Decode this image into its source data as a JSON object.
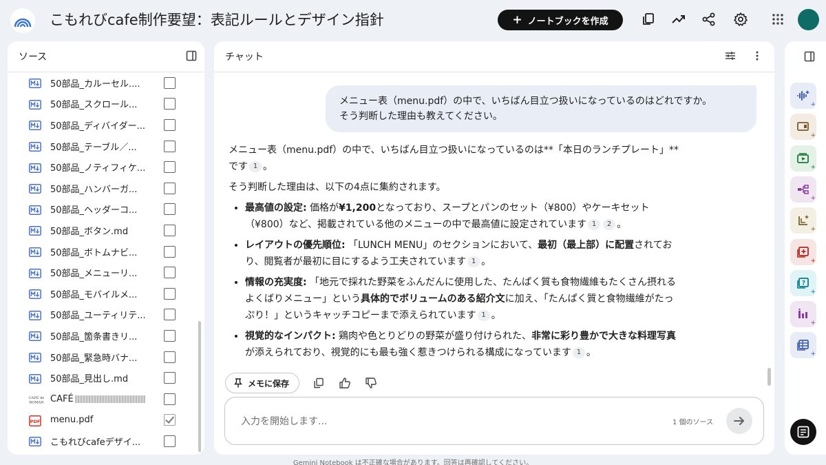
{
  "app": {
    "title": "こもれびcafe制作要望：表記ルールとデザイン指針",
    "create_notebook_label": "ノートブックを作成"
  },
  "sources_panel": {
    "title": "ソース",
    "items": [
      {
        "label": "50部品_カルーセル....",
        "icon": "markdown-icon",
        "checked": false
      },
      {
        "label": "50部品_スクロール...",
        "icon": "markdown-icon",
        "checked": false
      },
      {
        "label": "50部品_ディバイダー...",
        "icon": "markdown-icon",
        "checked": false
      },
      {
        "label": "50部品_テーブル／...",
        "icon": "markdown-icon",
        "checked": false
      },
      {
        "label": "50部品_ノティフィケ...",
        "icon": "markdown-icon",
        "checked": false
      },
      {
        "label": "50部品_ハンバーガ...",
        "icon": "markdown-icon",
        "checked": false
      },
      {
        "label": "50部品_ヘッダーコ...",
        "icon": "markdown-icon",
        "checked": false
      },
      {
        "label": "50部品_ボタン.md",
        "icon": "markdown-icon",
        "checked": false
      },
      {
        "label": "50部品_ボトムナビ...",
        "icon": "markdown-icon",
        "checked": false
      },
      {
        "label": "50部品_メニューリ...",
        "icon": "markdown-icon",
        "checked": false
      },
      {
        "label": "50部品_モバイルメ...",
        "icon": "markdown-icon",
        "checked": false
      },
      {
        "label": "50部品_ユーティリテ...",
        "icon": "markdown-icon",
        "checked": false
      },
      {
        "label": "50部品_箇条書きリ...",
        "icon": "markdown-icon",
        "checked": false
      },
      {
        "label": "50部品_緊急時バナ...",
        "icon": "markdown-icon",
        "checked": false
      },
      {
        "label": "50部品_見出し.md",
        "icon": "markdown-icon",
        "checked": false
      },
      {
        "label": "CAFÉ",
        "icon": "cafe-logo-icon",
        "checked": false
      },
      {
        "label": "menu.pdf",
        "icon": "pdf-icon",
        "checked": true
      },
      {
        "label": "こもれびcafeデザイ...",
        "icon": "markdown-icon",
        "checked": false
      }
    ]
  },
  "chat_panel": {
    "title": "チャット",
    "user_message_line1": "メニュー表（menu.pdf）の中で、いちばん目立つ扱いになっているのはどれですか。",
    "user_message_line2": "そう判断した理由も教えてください。",
    "answer": {
      "intro_pre": "メニュー表（menu.pdf）の中で、いちばん目立つ扱いになっているのは**「本日のランチプレート」**です",
      "intro_cite": "1",
      "intro_post": "。",
      "reason_lead": "そう判断した理由は、以下の4点に集約されます。",
      "b1_head": "最高値の設定:",
      "b1_t1": " 価格が",
      "b1_b1": "¥1,200",
      "b1_t2": "となっており、スープとパンのセット（¥800）やケーキセット（¥800）など、掲載されている他のメニューの中で最高値に設定されています",
      "b1_c1": "1",
      "b1_c2": "2",
      "b1_end": "。",
      "b2_head": "レイアウトの優先順位:",
      "b2_t1": " 「LUNCH MENU」のセクションにおいて、",
      "b2_b1": "最初（最上部）に配置",
      "b2_t2": "されており、閲覧者が最初に目にするよう工夫されています",
      "b2_c1": "1",
      "b2_end": "。",
      "b3_head": "情報の充実度:",
      "b3_t1": " 「地元で採れた野菜をふんだんに使用した、たんぱく質も食物繊維もたくさん摂れるよくばりメニュー」という",
      "b3_b1": "具体的でボリュームのある紹介文",
      "b3_t2": "に加え、「たんぱく質と食物繊維がたっぷり！」というキャッチコピーまで添えられています",
      "b3_c1": "1",
      "b3_end": "。",
      "b4_head": "視覚的なインパクト:",
      "b4_t1": " 鶏肉や色とりどりの野菜が盛り付けられた、",
      "b4_b1": "非常に彩り豊かで大きな料理写真",
      "b4_t2": "が添えられており、視覚的にも最も強く惹きつけられる構成になっています",
      "b4_c1": "1",
      "b4_end": "。"
    },
    "save_to_memo_label": "メモに保存",
    "input_placeholder": "入力を開始します...",
    "source_count": "1 個のソース"
  },
  "footer": {
    "disclaimer": "Gemini Notebook は不正確な場合があります。回答は再確認してください。"
  },
  "studio_tiles": [
    {
      "icon": "audio-overview-icon",
      "bg": "#e8ecf7",
      "color": "#3b5bb5"
    },
    {
      "icon": "slides-icon",
      "bg": "#f2ece3",
      "color": "#7a5a2a"
    },
    {
      "icon": "video-overview-icon",
      "bg": "#e3f1e7",
      "color": "#1e7a3c"
    },
    {
      "icon": "mind-map-icon",
      "bg": "#efe6f2",
      "color": "#8a3aa0"
    },
    {
      "icon": "report-icon",
      "bg": "#f3efe3",
      "color": "#7a6230"
    },
    {
      "icon": "flashcard-icon",
      "bg": "#f6e5e3",
      "color": "#b3261e"
    },
    {
      "icon": "quiz-icon",
      "bg": "#e0f3f6",
      "color": "#087a8c"
    },
    {
      "icon": "infographic-icon",
      "bg": "#efe6f2",
      "color": "#8a3aa0"
    },
    {
      "icon": "data-table-icon",
      "bg": "#e8ecf7",
      "color": "#3b5bb5"
    }
  ]
}
